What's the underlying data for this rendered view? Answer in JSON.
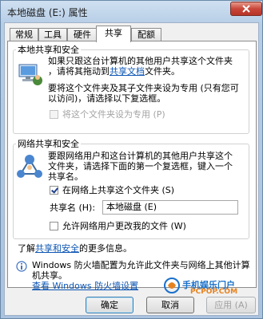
{
  "window": {
    "title": "本地磁盘 (E:) 属性"
  },
  "tabs": [
    "常规",
    "工具",
    "硬件",
    "共享",
    "配额"
  ],
  "local": {
    "group_title": "本地共享和安全",
    "para1_line1": "如果只跟这台计算机的其他用户共享这个文件夹",
    "para1_line2_prefix": "，请将其拖动到",
    "para1_link": "共享文档",
    "para1_line2_suffix": "文件夹。",
    "para2_line1": "要将这个文件夹及其子文件夹设为专用 (只有您可",
    "para2_line2": "以访问)，请选择以下复选框。",
    "private_checkbox_label": "将这个文件夹设为专用 (P)",
    "private_checked": false
  },
  "network": {
    "group_title": "网络共享和安全",
    "para_line1": "要跟网络用户和这台计算机的其他用户共享这个",
    "para_line2": "文件夹，请选择下面的第一个复选框，键入一个",
    "para_line3": "共享名。",
    "share_checkbox_label": "在网络上共享这个文件夹 (S)",
    "share_checked": true,
    "share_name_label": "共享名 (H):",
    "share_name_value": "本地磁盘 (E)",
    "allow_checkbox_label": "允许网络用户更改我的文件 (W)",
    "allow_checked": false,
    "learn_prefix": "了解",
    "learn_link": "共享和安全",
    "learn_suffix": "的更多信息。"
  },
  "firewall": {
    "line1": "Windows 防火墙配置为允许此文件夹与网络上其他计算",
    "line2": "机共享。",
    "link": "查看 Windows 防火墙设置"
  },
  "buttons": {
    "ok": "确定",
    "cancel": "取消",
    "apply": "应用 (A)"
  },
  "watermark": {
    "brand": "手机娱乐门户",
    "url": "PCPOP.COM"
  },
  "colors": {
    "link": "#0b54b3",
    "title_gradient_top": "#cfe0f1",
    "close_button": "#c9473a"
  }
}
